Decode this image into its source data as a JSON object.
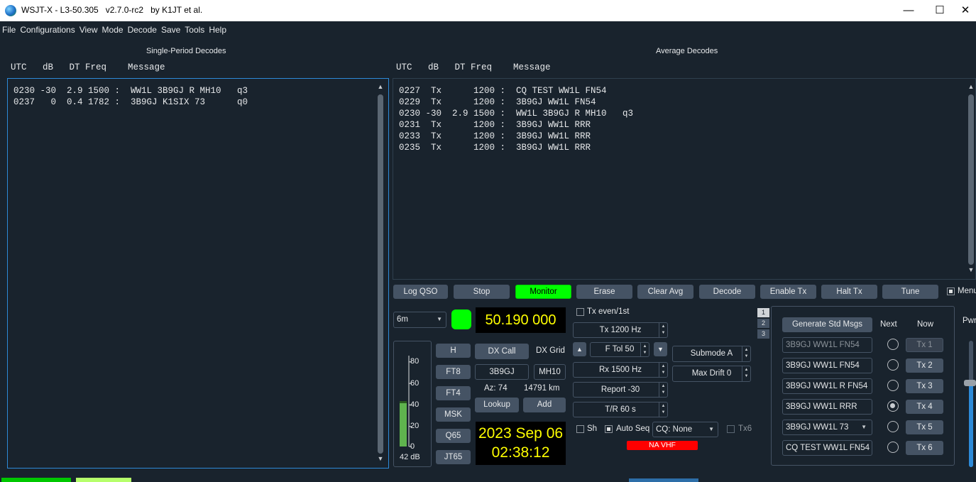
{
  "window": {
    "title": "WSJT-X - L3-50.305   v2.7.0-rc2   by K1JT et al.",
    "minimize": "—",
    "maximize": "☐",
    "close": "✕"
  },
  "menu": [
    "File",
    "Configurations",
    "View",
    "Mode",
    "Decode",
    "Save",
    "Tools",
    "Help"
  ],
  "left_panel": {
    "label": "Single-Period Decodes",
    "header": "UTC   dB   DT Freq    Message",
    "lines": [
      "0230 -30  2.9 1500 :  WW1L 3B9GJ R MH10   q3",
      "0237   0  0.4 1782 :  3B9GJ K1SIX 73      q0"
    ]
  },
  "right_panel": {
    "label": "Average Decodes",
    "header": "UTC   dB   DT Freq    Message",
    "lines": [
      "0227  Tx      1200 :  CQ TEST WW1L FN54",
      "0229  Tx      1200 :  3B9GJ WW1L FN54",
      "0230 -30  2.9 1500 :  WW1L 3B9GJ R MH10   q3",
      "0231  Tx      1200 :  3B9GJ WW1L RRR",
      "0233  Tx      1200 :  3B9GJ WW1L RRR",
      "0235  Tx      1200 :  3B9GJ WW1L RRR"
    ]
  },
  "buttons": {
    "log_qso": "Log QSO",
    "stop": "Stop",
    "monitor": "Monitor",
    "erase": "Erase",
    "clear_avg": "Clear Avg",
    "decode": "Decode",
    "enable_tx": "Enable Tx",
    "halt_tx": "Halt Tx",
    "tune": "Tune",
    "menus": "Menus"
  },
  "band": "6m",
  "frequency": "50.190 000",
  "meter": {
    "ticks": [
      "80",
      "60",
      "40",
      "20",
      "0"
    ],
    "level_db": 42,
    "reading": "42 dB"
  },
  "mode_buttons": [
    "H",
    "FT8",
    "FT4",
    "MSK",
    "Q65",
    "JT65"
  ],
  "dx": {
    "call_button": "DX Call",
    "grid_label": "DX Grid",
    "call": "3B9GJ",
    "grid": "MH10",
    "az": "Az: 74",
    "distance": "14791 km",
    "lookup": "Lookup",
    "add": "Add"
  },
  "clock": {
    "date": "2023 Sep 06",
    "time": "02:38:12"
  },
  "controls": {
    "tx_even": "Tx even/1st",
    "tx_freq": "Tx  1200  Hz",
    "f_tol": "F Tol  50",
    "rx_freq": "Rx  1500  Hz",
    "report": "Report -30",
    "tr": "T/R  60  s",
    "submode": "Submode A",
    "max_drift": "Max Drift  0",
    "sh": "Sh",
    "auto_seq": "Auto Seq",
    "cq": "CQ: None",
    "tx6": "Tx6",
    "na_vhf": "NA VHF"
  },
  "tabs": [
    "1",
    "2",
    "3"
  ],
  "messages": {
    "generate": "Generate Std Msgs",
    "next": "Next",
    "now": "Now",
    "rows": [
      {
        "text": "3B9GJ WW1L FN54",
        "tx": "Tx 1"
      },
      {
        "text": "3B9GJ WW1L FN54",
        "tx": "Tx 2"
      },
      {
        "text": "3B9GJ WW1L R FN54",
        "tx": "Tx 3"
      },
      {
        "text": "3B9GJ WW1L RRR",
        "tx": "Tx 4"
      },
      {
        "text": "3B9GJ WW1L 73",
        "tx": "Tx 5"
      },
      {
        "text": "CQ TEST WW1L FN54",
        "tx": "Tx 6"
      }
    ],
    "selected_row": 4
  },
  "pwr_label": "Pwr",
  "colors": {
    "background": "#19232d",
    "button": "#455364",
    "monitor_on": "#00ff00",
    "lcd_text": "#ffff00",
    "alert": "#ff0000",
    "focus": "#2d8ad8"
  }
}
